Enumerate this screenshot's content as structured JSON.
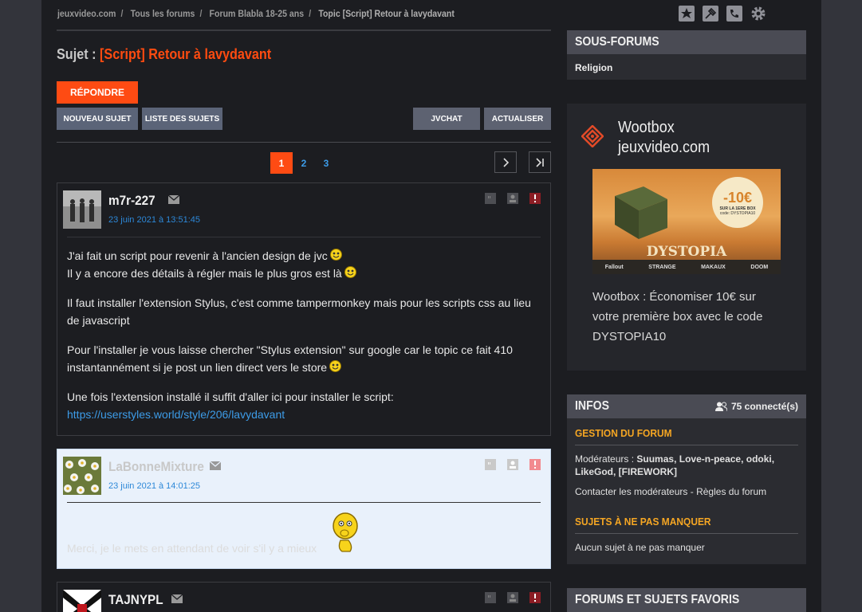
{
  "breadcrumb": [
    "jeuxvideo.com",
    "Tous les forums",
    "Forum Blabla 18-25 ans",
    "Topic [Script] Retour à lavydavant"
  ],
  "top_icons": [
    "star-icon",
    "pin-icon",
    "phone-icon",
    "gear-icon"
  ],
  "subject": {
    "label": "Sujet :",
    "title": "[Script] Retour à lavydavant"
  },
  "buttons": {
    "reply": "Répondre",
    "new_topic": "Nouveau sujet",
    "topic_list": "Liste des sujets",
    "jvchat": "JVCHAT",
    "refresh": "Actualiser"
  },
  "pagination": {
    "pages": [
      "1",
      "2",
      "3"
    ],
    "current": "1"
  },
  "posts": [
    {
      "author": "m7r-227",
      "date": "23 juin 2021 à 13:51:45",
      "paragraphs": [
        "J'ai fait un script pour revenir à l'ancien design de jvc",
        "Il y a encore des détails à régler mais le plus gros est là",
        "Il faut installer l'extension Stylus, c'est comme tampermonkey mais pour les scripts css au lieu de javascript",
        "Pour l'installer je vous laisse chercher \"Stylus extension\" sur google car le topic ce fait 410 instantannément si je post un lien direct vers le store",
        "Une fois l'extension installé il suffit d'aller ici pour installer le script:"
      ],
      "link": "https://userstyles.world/style/206/lavydavant"
    },
    {
      "author": "LaBonneMixture",
      "date": "23 juin 2021 à 14:01:25",
      "paragraphs": [
        "Merci, je le mets en attendant de voir s'il y a mieux"
      ]
    },
    {
      "author": "TAJNYPL"
    }
  ],
  "sidebar": {
    "subforums": {
      "title": "Sous-forums",
      "items": [
        "Religion"
      ]
    },
    "wootbox": {
      "title_line1": "Wootbox",
      "title_line2": "jeuxvideo.com",
      "banner": {
        "price": "-10€",
        "price_sub": "SUR LA 1ERE BOX",
        "code_line": "code: DYSTOPIA10",
        "name": "DYSTOPIA",
        "logos": [
          "Fallout",
          "STRANGE",
          "MAKAUX",
          "DOOM"
        ]
      },
      "description": "Wootbox : Économiser 10€ sur votre première box avec le code DYSTOPIA10"
    },
    "infos": {
      "title": "Infos",
      "connected": "75 connecté(s)",
      "gestion_title": "Gestion du forum",
      "moderators_label": "Modérateurs :",
      "moderators": "Suumas, Love-n-peace, odoki, LikeGod, [FIREWORK]",
      "contact": "Contacter les modérateurs",
      "sep": "-",
      "rules": "Règles du forum",
      "must_title": "Sujets à ne pas manquer",
      "must_text": "Aucun sujet à ne pas manquer"
    },
    "favorites": {
      "title": "Forums et sujets favoris"
    }
  }
}
